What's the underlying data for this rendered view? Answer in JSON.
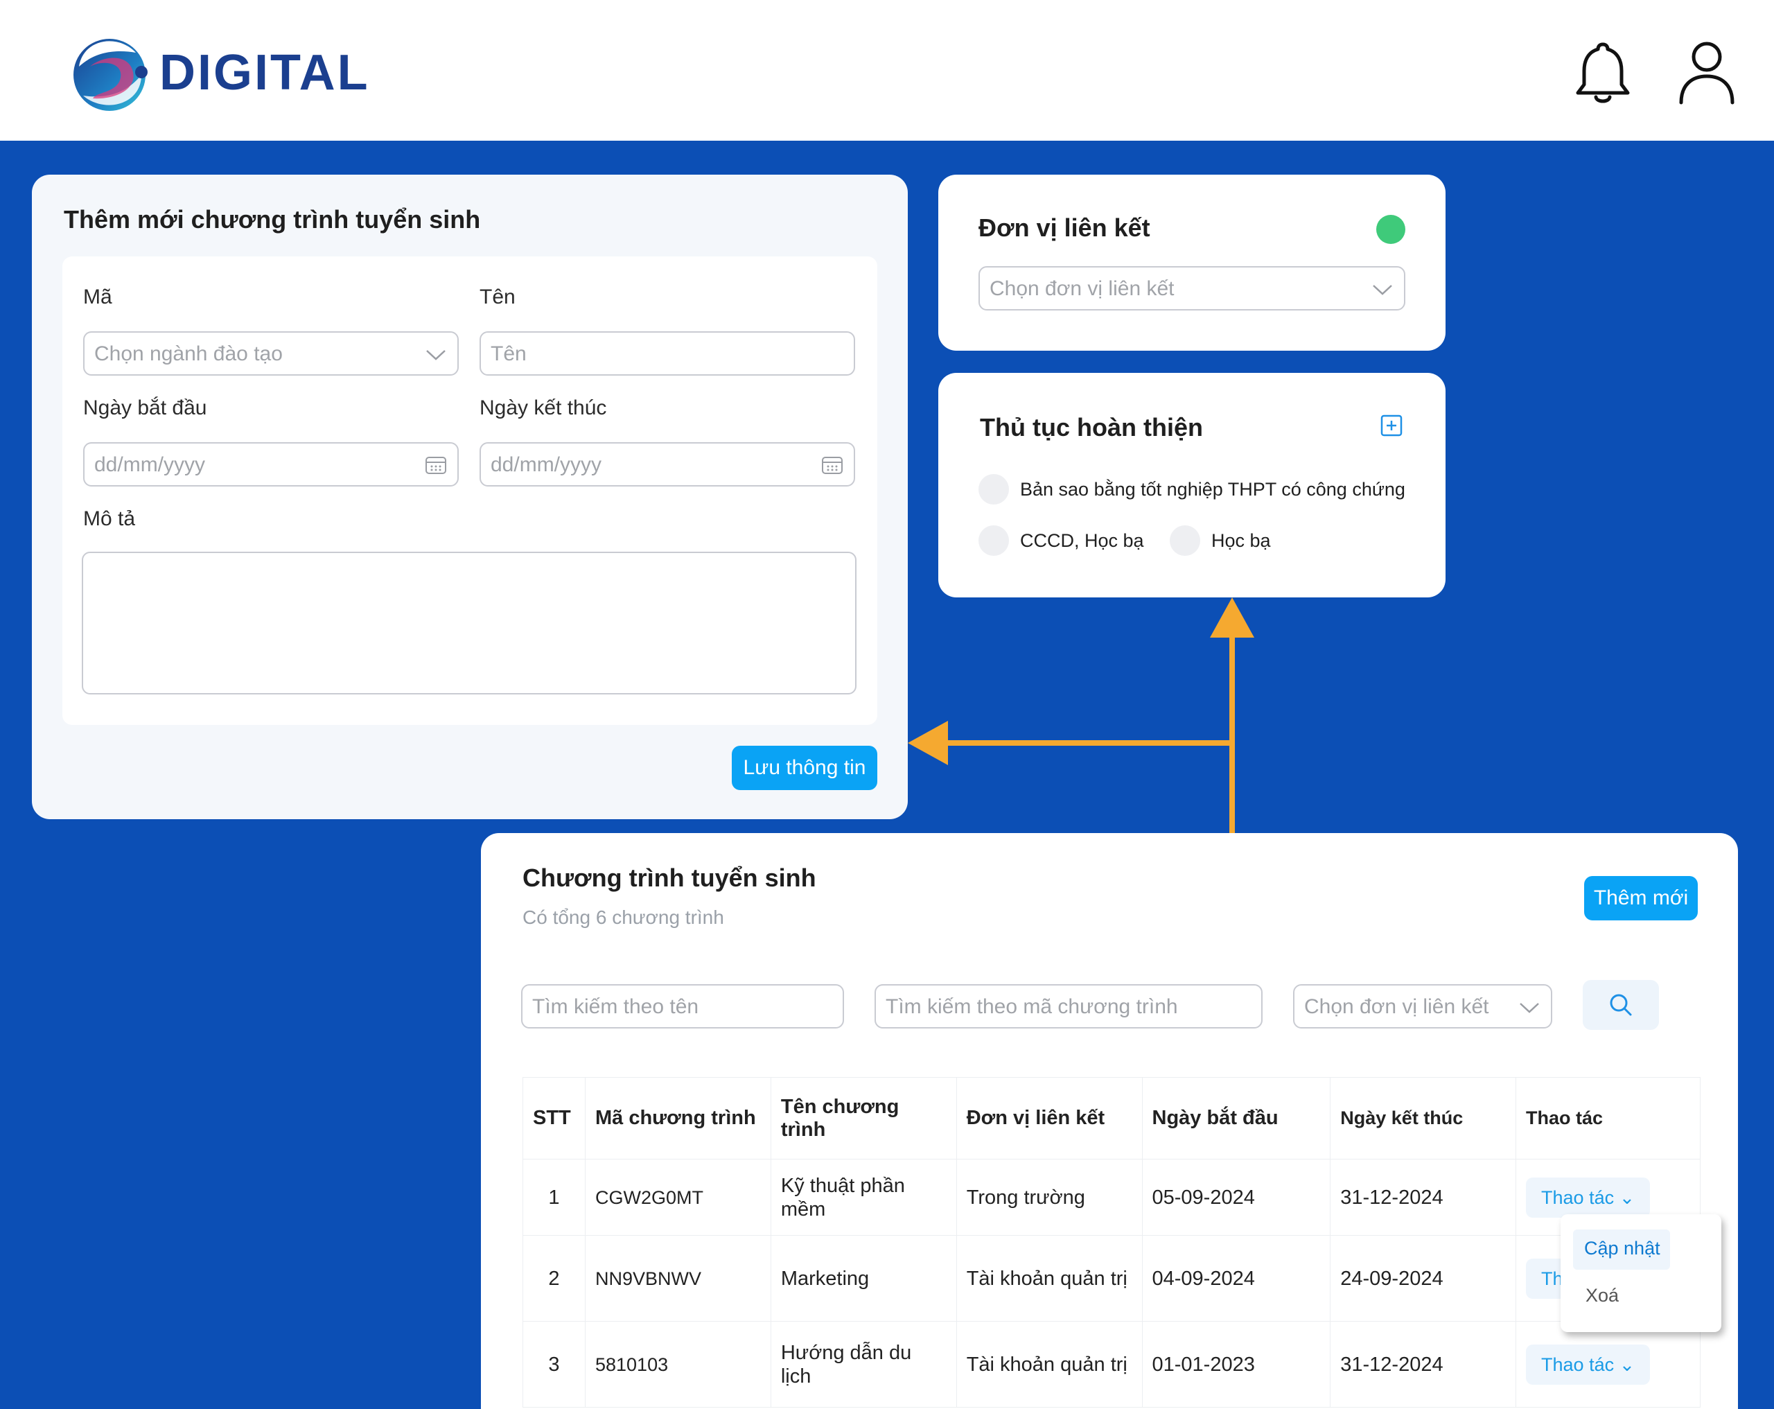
{
  "header": {
    "logo_text": "DIGITAL",
    "icons": [
      "bell-icon",
      "user-icon"
    ]
  },
  "form": {
    "title": "Thêm mới chương trình tuyển sinh",
    "ma_label": "Mã",
    "ma_placeholder": "Chọn ngành đào tạo",
    "ten_label": "Tên",
    "ten_placeholder": "Tên",
    "start_label": "Ngày bắt đầu",
    "start_placeholder": "dd/mm/yyyy",
    "end_label": "Ngày kết thúc",
    "end_placeholder": "dd/mm/yyyy",
    "desc_label": "Mô tả",
    "save_label": "Lưu thông tin"
  },
  "unit": {
    "title": "Đơn vị liên kết",
    "placeholder": "Chọn đơn vị liên kết",
    "status_color": "#3fca7a"
  },
  "procedure": {
    "title": "Thủ tục hoàn thiện",
    "items": [
      "Bản sao bằng tốt nghiệp THPT có công chứng",
      "CCCD, Học bạ",
      "Học bạ"
    ]
  },
  "list": {
    "title": "Chương trình tuyển sinh",
    "subtitle": "Có tổng 6 chương trình",
    "add_label": "Thêm mới",
    "search_name_placeholder": "Tìm kiếm theo tên",
    "search_code_placeholder": "Tìm kiếm theo mã chương trình",
    "unit_select_placeholder": "Chọn đơn vị liên kết",
    "columns": [
      "STT",
      "Mã chương trình",
      "Tên chương trình",
      "Đơn vị liên kết",
      "Ngày bắt đầu",
      "Ngày kết thúc",
      "Thao tác"
    ],
    "rows": [
      {
        "stt": "1",
        "code": "CGW2G0MT",
        "name": "Kỹ  thuật phần mềm",
        "unit": "Trong trường",
        "start": "05-09-2024",
        "end": "31-12-2024",
        "action": "Thao tác"
      },
      {
        "stt": "2",
        "code": "NN9VBNWV",
        "name": "Marketing",
        "unit": "Tài khoản quản trị",
        "start": "04-09-2024",
        "end": "24-09-2024",
        "action": "Th"
      },
      {
        "stt": "3",
        "code": "5810103",
        "name": "Hướng dẫn du lịch",
        "unit": "Tài khoản quản trị",
        "start": "01-01-2023",
        "end": "31-12-2024",
        "action": "Thao tác"
      }
    ],
    "menu": {
      "update": "Cập nhật",
      "delete": "Xoá"
    }
  },
  "colors": {
    "background": "#0c4fb5",
    "accent": "#0aa3f5",
    "arrow": "#f5a930"
  }
}
